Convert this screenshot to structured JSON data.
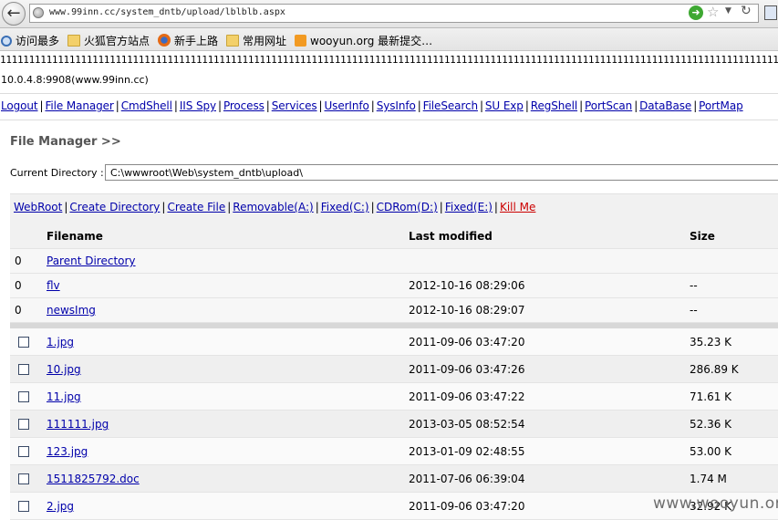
{
  "browser": {
    "url": "www.99inn.cc/system_dntb/upload/lblblb.aspx",
    "bookmarks": [
      {
        "label": "访问最多",
        "icon": "magnifier-icon"
      },
      {
        "label": "火狐官方站点",
        "icon": "folder-icon"
      },
      {
        "label": "新手上路",
        "icon": "firefox-icon"
      },
      {
        "label": "常用网址",
        "icon": "folder-icon"
      },
      {
        "label": "wooyun.org 最新提交…",
        "icon": "rss-icon"
      }
    ]
  },
  "page": {
    "ones": "111111111111111111111111111111111111111111111111111111111111111111111111111111111111111111111111111111111111111111111111111111111111111111111111",
    "host": "10.0.4.8:9908(www.99inn.cc)",
    "nav": [
      "Logout",
      "File Manager",
      "CmdShell",
      "IIS Spy",
      "Process",
      "Services",
      "UserInfo",
      "SysInfo",
      "FileSearch",
      "SU Exp",
      "RegShell",
      "PortScan",
      "DataBase",
      "PortMap"
    ],
    "title": "File Manager >>",
    "current_directory_label": "Current Directory :",
    "current_directory": "C:\\wwwroot\\Web\\system_dntb\\upload\\",
    "toolbar": [
      "WebRoot",
      "Create Directory",
      "Create File",
      "Removable(A:)",
      "Fixed(C:)",
      "CDRom(D:)",
      "Fixed(E:)",
      "Kill Me"
    ],
    "table": {
      "headers": {
        "filename": "Filename",
        "modified": "Last modified",
        "size": "Size"
      },
      "dirs": [
        {
          "num": "0",
          "name": "Parent Directory",
          "modified": "",
          "size": ""
        },
        {
          "num": "0",
          "name": "flv",
          "modified": "2012-10-16 08:29:06",
          "size": "--"
        },
        {
          "num": "0",
          "name": "newsImg",
          "modified": "2012-10-16 08:29:07",
          "size": "--"
        }
      ],
      "files": [
        {
          "name": "1.jpg",
          "modified": "2011-09-06 03:47:20",
          "size": "35.23 K"
        },
        {
          "name": "10.jpg",
          "modified": "2011-09-06 03:47:26",
          "size": "286.89 K"
        },
        {
          "name": "11.jpg",
          "modified": "2011-09-06 03:47:22",
          "size": "71.61 K"
        },
        {
          "name": "111111.jpg",
          "modified": "2013-03-05 08:52:54",
          "size": "52.36 K"
        },
        {
          "name": "123.jpg",
          "modified": "2013-01-09 02:48:55",
          "size": "53.00 K"
        },
        {
          "name": "1511825792.doc",
          "modified": "2011-07-06 06:39:04",
          "size": "1.74 M"
        },
        {
          "name": "2.jpg",
          "modified": "2011-09-06 03:47:20",
          "size": "32.92 K"
        }
      ]
    }
  },
  "watermark": "www.wooyun.org"
}
